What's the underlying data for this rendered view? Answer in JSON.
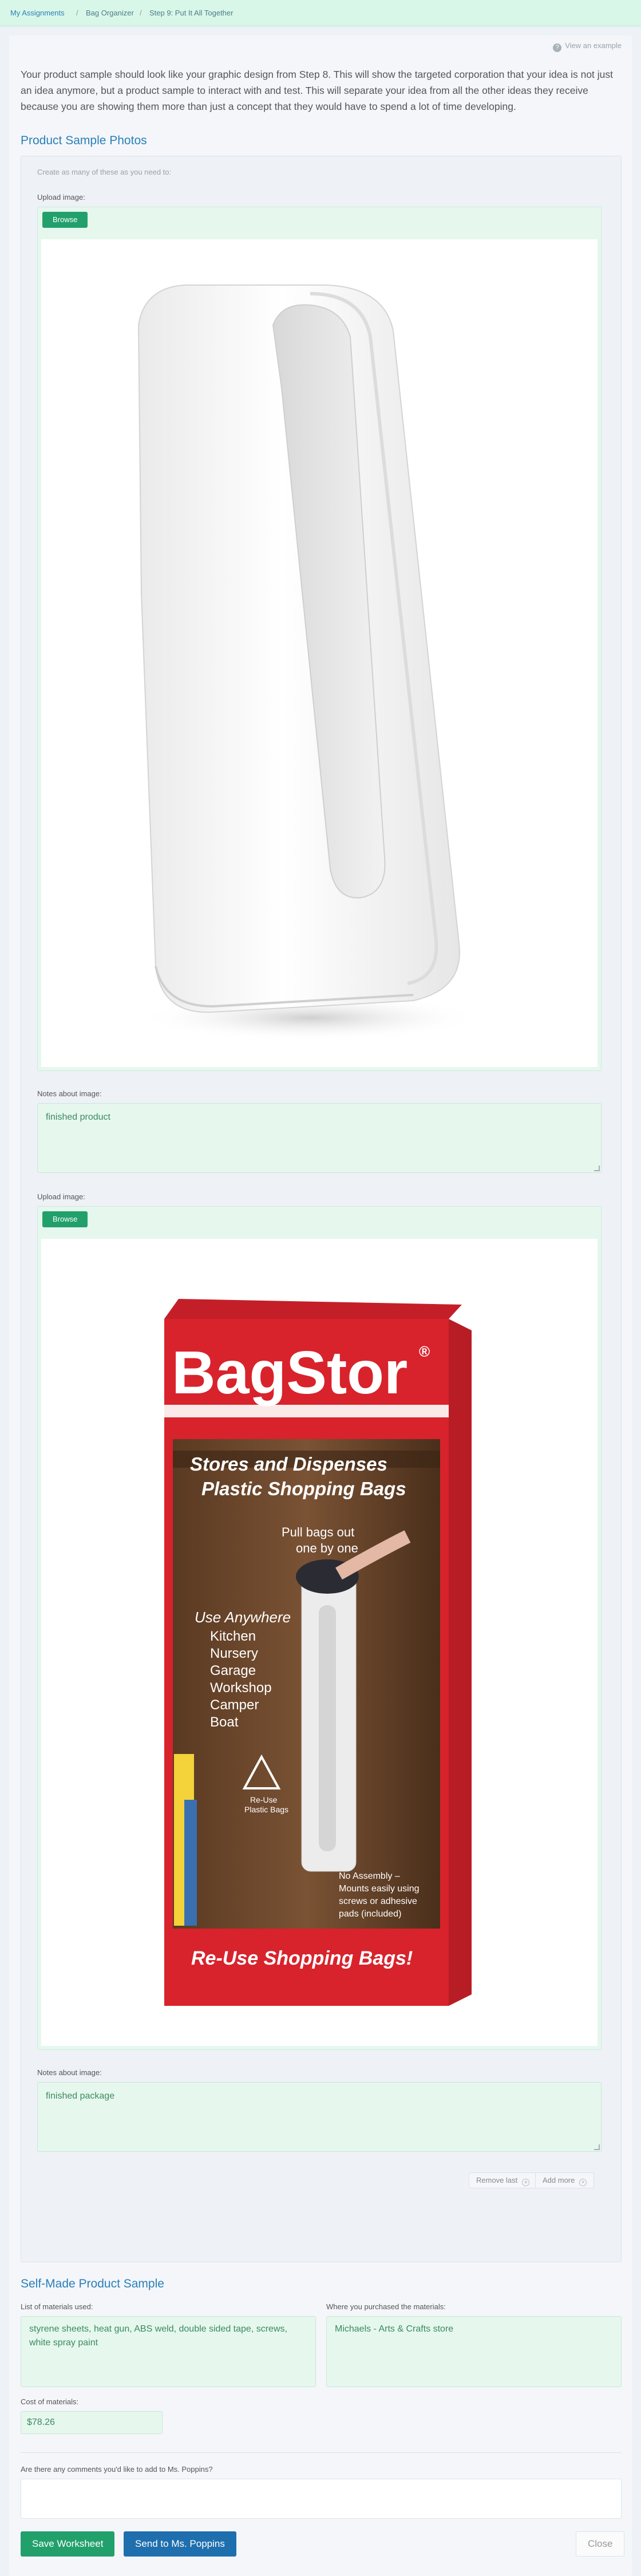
{
  "breadcrumb": {
    "items": [
      "My Assignments",
      "Bag Organizer",
      "Step 9: Put It All Together"
    ],
    "separator": "/"
  },
  "header": {
    "example_icon": "question-circle-icon",
    "example_link": "View an example"
  },
  "intro_text": "Your product sample should look like your graphic design from Step 8. This will show the targeted corporation that your idea is not just an idea anymore, but a product sample to interact with and test. This will separate your idea from all the other ideas they receive because you are showing them more than just a concept that they would have to spend a lot of time developing.",
  "photos": {
    "title": "Product Sample Photos",
    "hint": "Create as many of these as you need to:",
    "items": [
      {
        "upload_label": "Upload image:",
        "browse_label": "Browse",
        "image": "white-bag-dispenser-product-photo",
        "notes_label": "Notes about image:",
        "notes_value": "finished product"
      },
      {
        "upload_label": "Upload image:",
        "browse_label": "Browse",
        "image": "bagstor-package-photo",
        "notes_label": "Notes about image:",
        "notes_value": "finished package",
        "package": {
          "brand": "BagStor",
          "registered": "®",
          "headline_line1": "Stores and Dispenses",
          "headline_line2": "Plastic Shopping Bags",
          "pull_line1": "Pull bags out",
          "pull_line2": "one by one",
          "use_title": "Use Anywhere",
          "use_list": [
            "Kitchen",
            "Nursery",
            "Garage",
            "Workshop",
            "Camper",
            "Boat"
          ],
          "recycle_line1": "Re-Use",
          "recycle_line2": "Plastic Bags",
          "assembly_lines": [
            "No Assembly –",
            "Mounts easily using",
            "screws or adhesive",
            "pads (included)"
          ],
          "footer": "Re-Use Shopping Bags!"
        }
      }
    ],
    "remove_last_label": "Remove last",
    "add_more_label": "Add more"
  },
  "self_made": {
    "title": "Self-Made Product Sample",
    "materials_label": "List of materials used:",
    "materials_value": "styrene sheets, heat gun, ABS weld, double sided tape, screws, white spray paint",
    "purchased_label": "Where you purchased the materials:",
    "purchased_value": "Michaels - Arts & Crafts store",
    "cost_label": "Cost of materials:",
    "cost_value": "$78.26"
  },
  "comments": {
    "label": "Are there any comments you'd like to add to Ms. Poppins?",
    "value": ""
  },
  "actions": {
    "save_label": "Save Worksheet",
    "send_label": "Send to Ms. Poppins",
    "close_label": "Close"
  },
  "colors": {
    "accent_green": "#22a06b",
    "accent_blue": "#1f6fae",
    "link_blue": "#2a7fb8",
    "field_bg": "#e6f7ee",
    "package_red": "#d8232c"
  }
}
